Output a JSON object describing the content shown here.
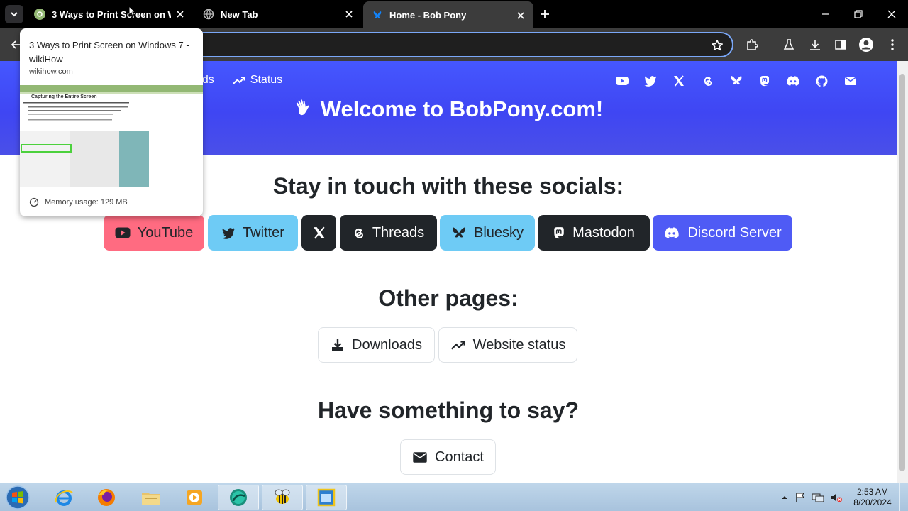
{
  "browser": {
    "tabs": [
      {
        "title": "3 Ways to Print Screen on Windows 7 - wikiHow",
        "favicon": "wikihow-icon",
        "active": false
      },
      {
        "title": "New Tab",
        "favicon": "chrome-globe-icon",
        "active": false
      },
      {
        "title": "Home - Bob Pony",
        "favicon": "bluesky-icon",
        "active": true
      }
    ],
    "hover_card": {
      "title": "3 Ways to Print Screen on Windows 7 - wikiHow",
      "domain": "wikihow.com",
      "memory": "Memory usage: 129 MB",
      "thumbnail_heading": "Capturing the Entire Screen"
    },
    "omnibox_text": ""
  },
  "site": {
    "nav": [
      {
        "label": "ads",
        "icon": "download-icon"
      },
      {
        "label": "Status",
        "icon": "trending-up-icon"
      }
    ],
    "header_icons": [
      "youtube-icon",
      "twitter-icon",
      "x-icon",
      "threads-icon",
      "bluesky-icon",
      "mastodon-icon",
      "discord-icon",
      "github-icon",
      "mail-icon"
    ],
    "welcome": "Welcome to BobPony.com!",
    "socials_heading": "Stay in touch with these socials:",
    "socials": [
      {
        "label": "YouTube",
        "icon": "youtube-icon",
        "color": "#ff6b81"
      },
      {
        "label": "Twitter",
        "icon": "twitter-icon",
        "color": "#6ecbf5"
      },
      {
        "label": "",
        "icon": "x-icon",
        "color": "#212529"
      },
      {
        "label": "Threads",
        "icon": "threads-icon",
        "color": "#212529"
      },
      {
        "label": "Bluesky",
        "icon": "bluesky-icon",
        "color": "#6ecbf5"
      },
      {
        "label": "Mastodon",
        "icon": "mastodon-icon",
        "color": "#212529"
      },
      {
        "label": "Discord Server",
        "icon": "discord-icon",
        "color": "#4f5bf5"
      }
    ],
    "other_heading": "Other pages:",
    "other_pages": [
      {
        "label": "Downloads",
        "icon": "download-icon"
      },
      {
        "label": "Website status",
        "icon": "trending-up-icon"
      }
    ],
    "say_heading": "Have something to say?",
    "contact": {
      "label": "Contact",
      "icon": "mail-icon"
    }
  },
  "taskbar": {
    "apps": [
      "internet-explorer-icon",
      "firefox-icon",
      "file-explorer-icon",
      "media-player-icon",
      "chrome-app-icon",
      "bee-app-icon",
      "window-app-icon"
    ],
    "time": "2:53 AM",
    "date": "8/20/2024"
  }
}
